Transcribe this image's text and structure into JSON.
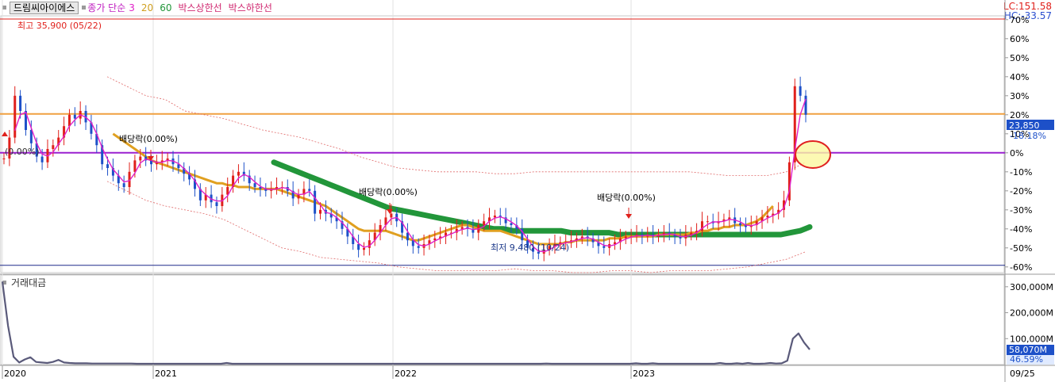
{
  "legend": {
    "stock_name": "드림씨아이에스",
    "ma_title": "종가 단순",
    "ma_periods": [
      "3",
      "20",
      "60"
    ],
    "box_upper": "박스상한선",
    "box_lower": "박스하한선"
  },
  "volume_legend": "거래대금",
  "lc_label": "LC:151.58",
  "hc_label": "HC:-33.57",
  "colors": {
    "up": "#e0201b",
    "down": "#1d50c8",
    "ma3": "#e020c8",
    "ma20": "#e0a020",
    "ma60": "#22963a",
    "high_line": "#e0201b",
    "box_upper": "#f0a040",
    "base_line": "#9a20d0",
    "low_line": "#1f2a8a",
    "envelope": "#e06a6a",
    "volume_line": "#5a5a7a",
    "axis_highlight": "#1d50c8",
    "circle": "#e02020",
    "circle_fill": "#fbf7a0"
  },
  "chart_data": [
    {
      "type": "candlestick",
      "title": "",
      "y_axis_unit": "%",
      "y_ticks": [
        "70%",
        "60%",
        "50%",
        "40%",
        "30%",
        "20%",
        "10%",
        "0%",
        "-10%",
        "-20%",
        "-30%",
        "-40%",
        "-50%",
        "-60%"
      ],
      "x_ticks": [
        "2020",
        "2021",
        "2022",
        "2023",
        "09/25"
      ],
      "current_price_label": "23,850",
      "current_change_label": "-18.18%",
      "annotations": [
        {
          "text": "최고 35,900 (05/22)"
        },
        {
          "text": "(0.00%)"
        },
        {
          "text": "배당락(0.00%)"
        },
        {
          "text": "배당락(0.00%)"
        },
        {
          "text": "배당락(0.00%)"
        },
        {
          "text": "최저 9,480 (10/24)"
        }
      ],
      "reference_lines_pct": {
        "high": 72,
        "box_upper": 20,
        "base": 0,
        "low": -55
      },
      "close_pct": [
        -3,
        8,
        30,
        22,
        12,
        5,
        -2,
        -5,
        2,
        4,
        8,
        14,
        20,
        18,
        22,
        16,
        10,
        4,
        -6,
        -8,
        -12,
        -16,
        -18,
        -10,
        -4,
        -2,
        -4,
        -6,
        -5,
        -4,
        -3,
        -6,
        -8,
        -11,
        -14,
        -19,
        -25,
        -22,
        -26,
        -28,
        -22,
        -18,
        -12,
        -10,
        -12,
        -16,
        -18,
        -19,
        -20,
        -19,
        -18,
        -18,
        -20,
        -24,
        -22,
        -19,
        -20,
        -32,
        -30,
        -32,
        -34,
        -36,
        -40,
        -44,
        -48,
        -51,
        -50,
        -46,
        -42,
        -38,
        -34,
        -32,
        -36,
        -42,
        -46,
        -49,
        -50,
        -48,
        -46,
        -45,
        -44,
        -42,
        -42,
        -40,
        -39,
        -40,
        -42,
        -38,
        -36,
        -34,
        -33,
        -34,
        -37,
        -38,
        -40,
        -46,
        -50,
        -52,
        -53,
        -51,
        -49,
        -48,
        -47,
        -47,
        -46,
        -45,
        -44,
        -45,
        -47,
        -49,
        -50,
        -48,
        -47,
        -45,
        -44,
        -44,
        -43,
        -44,
        -43,
        -44,
        -43,
        -42,
        -43,
        -44,
        -45,
        -43,
        -42,
        -41,
        -36,
        -36,
        -37,
        -36,
        -35,
        -34,
        -37,
        -38,
        -39,
        -38,
        -36,
        -34,
        -33,
        -32,
        -30,
        -25,
        -5,
        35,
        30,
        20
      ],
      "ma20_pct": [
        null,
        null,
        null,
        null,
        null,
        null,
        null,
        null,
        null,
        null,
        null,
        null,
        null,
        null,
        null,
        null,
        null,
        null,
        null,
        null,
        10,
        8,
        6,
        4,
        2,
        0,
        -2,
        -4,
        -5,
        -6,
        -7,
        -8,
        -9,
        -10,
        -11,
        -12,
        -13,
        -14,
        -15,
        -16,
        -16,
        -17,
        -17,
        -18,
        -18,
        -18,
        -19,
        -19,
        -19,
        -19,
        -19,
        -20,
        -21,
        -22,
        -23,
        -24,
        -25,
        -26,
        -27,
        -28,
        -30,
        -32,
        -34,
        -36,
        -38,
        -40,
        -41,
        -41,
        -41,
        -41,
        -41,
        -42,
        -43,
        -44,
        -45,
        -46,
        -46,
        -45,
        -44,
        -43,
        -42,
        -41,
        -40,
        -39,
        -38,
        -38,
        -39,
        -40,
        -41,
        -41,
        -41,
        -41,
        -42,
        -43,
        -44,
        -45,
        -46,
        -47,
        -48,
        -48,
        -48,
        -48,
        -48,
        -47,
        -47,
        -46,
        -46,
        -46,
        -46,
        -46,
        -46,
        -45,
        -45,
        -45,
        -44,
        -44,
        -44,
        -44,
        -44,
        -44,
        -43,
        -43,
        -43,
        -43,
        -43,
        -43,
        -42,
        -42,
        -41,
        -41,
        -40,
        -40,
        -39,
        -39,
        -38,
        -38,
        -38,
        -37,
        -36,
        -34,
        -31,
        -28
      ],
      "ma60_pct": [
        null,
        null,
        null,
        null,
        null,
        null,
        null,
        null,
        null,
        null,
        null,
        null,
        null,
        null,
        null,
        null,
        null,
        null,
        null,
        null,
        null,
        null,
        null,
        null,
        null,
        null,
        null,
        null,
        null,
        null,
        null,
        null,
        null,
        null,
        null,
        null,
        null,
        null,
        null,
        null,
        null,
        null,
        null,
        null,
        null,
        null,
        null,
        null,
        null,
        null,
        null,
        null,
        null,
        null,
        null,
        null,
        null,
        null,
        null,
        null,
        null,
        null,
        null,
        null,
        null,
        null,
        null,
        null,
        null,
        null,
        null,
        null,
        null,
        null,
        null,
        null,
        null,
        null,
        null,
        null,
        null,
        null,
        null,
        null,
        null,
        null,
        null,
        null,
        null,
        null,
        null,
        null,
        null,
        null,
        null,
        null,
        null,
        null,
        null,
        null,
        null,
        null,
        null,
        null,
        null,
        null,
        null,
        null,
        null,
        null,
        null,
        null,
        null,
        null,
        null,
        null,
        null,
        null,
        null,
        null,
        null,
        null,
        null,
        null,
        null,
        null,
        null,
        null,
        null,
        null,
        null,
        null,
        null,
        null,
        null,
        null,
        null,
        null,
        null,
        null,
        null,
        null,
        null,
        null,
        null,
        null,
        null
      ],
      "ma60_line_pct": [
        -5,
        -7,
        -9,
        -11,
        -13,
        -15,
        -17,
        -19,
        -21,
        -23,
        -25,
        -27,
        -29,
        -30,
        -31,
        -32,
        -33,
        -34,
        -35,
        -36,
        -37,
        -38,
        -39,
        -40,
        -40,
        -41,
        -41,
        -41,
        -41,
        -41,
        -41,
        -42,
        -42,
        -42,
        -42,
        -42,
        -43,
        -43,
        -43,
        -43,
        -43,
        -43,
        -43,
        -43,
        -43,
        -43,
        -43,
        -43,
        -43,
        -43,
        -43,
        -43,
        -43,
        -43,
        -42,
        -41,
        -39
      ],
      "envelope_upper_pct": [
        40,
        35,
        30,
        28,
        22,
        20,
        18,
        15,
        12,
        10,
        8,
        5,
        2,
        -2,
        -5,
        -8,
        -9,
        -10,
        -10,
        -10,
        -11,
        -11,
        -10,
        -10,
        -10,
        -10,
        -10,
        -10,
        -10,
        -10,
        -10,
        -11,
        -12,
        -12,
        -12,
        -10,
        -5
      ],
      "envelope_lower_pct": [
        -15,
        -20,
        -25,
        -28,
        -30,
        -32,
        -35,
        -40,
        -45,
        -50,
        -52,
        -55,
        -56,
        -57,
        -58,
        -60,
        -61,
        -62,
        -62,
        -62,
        -62,
        -61,
        -62,
        -62,
        -63,
        -63,
        -62,
        -62,
        -63,
        -62,
        -62,
        -62,
        -61,
        -60,
        -58,
        -56,
        -52
      ]
    },
    {
      "type": "line",
      "title": "",
      "y_ticks": [
        "300,000M",
        "200,000M",
        "100,000M"
      ],
      "ylim": [
        0,
        330000
      ],
      "current_value_label": "58,070M",
      "current_pct_label": "46.59%",
      "values": [
        320000,
        150000,
        30000,
        8000,
        20000,
        28000,
        10000,
        8000,
        6000,
        10000,
        18000,
        8000,
        6000,
        5000,
        5000,
        5000,
        4000,
        4000,
        4000,
        4000,
        4000,
        4000,
        4000,
        4000,
        3000,
        3000,
        3000,
        3000,
        3000,
        3000,
        3000,
        3000,
        3000,
        3000,
        3000,
        3000,
        3000,
        3000,
        3000,
        3000,
        6000,
        3000,
        3000,
        3000,
        3000,
        3000,
        3000,
        3000,
        3000,
        3000,
        3000,
        3000,
        3000,
        3000,
        3000,
        3000,
        3000,
        3000,
        3000,
        3000,
        3000,
        3000,
        3000,
        3000,
        3000,
        3000,
        3000,
        3000,
        3000,
        3000,
        3000,
        3000,
        3000,
        3000,
        3000,
        3000,
        3000,
        3000,
        3000,
        3000,
        3000,
        3000,
        3000,
        3000,
        3000,
        3000,
        3000,
        3000,
        3000,
        3000,
        3000,
        3000,
        3000,
        3000,
        3000,
        3000,
        3000,
        4000,
        3000,
        3000,
        3000,
        3000,
        3000,
        3000,
        3000,
        3000,
        3000,
        3000,
        3000,
        3000,
        3000,
        3000,
        3000,
        5000,
        3000,
        3000,
        5000,
        3000,
        3000,
        3000,
        3000,
        3000,
        3000,
        3000,
        3000,
        3000,
        3000,
        3000,
        6000,
        3000,
        3000,
        5000,
        3000,
        6000,
        3000,
        3000,
        4000,
        6000,
        4000,
        5000,
        15000,
        100000,
        120000,
        85000,
        58070
      ]
    }
  ]
}
